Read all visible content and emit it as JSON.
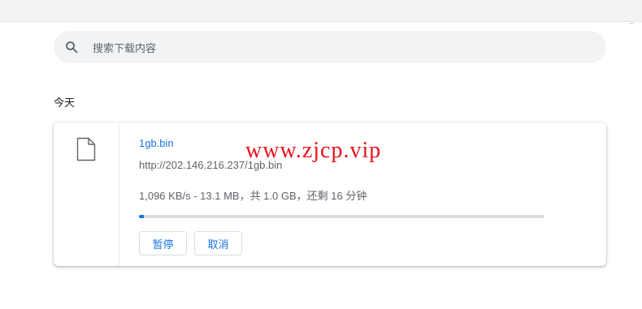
{
  "search": {
    "placeholder": "搜索下载内容",
    "icon": "search-icon"
  },
  "section": {
    "title": "今天"
  },
  "download": {
    "file_name": "1gb.bin",
    "url": "http://202.146.216.237/1gb.bin",
    "status_text": "1,096 KB/s - 13.1 MB，共 1.0 GB，还剩 16 分钟",
    "progress": 0.0128,
    "file_icon": "file-icon",
    "buttons": {
      "pause": "暂停",
      "cancel": "取消"
    }
  },
  "watermark": {
    "text": "www.zjcp.vip"
  },
  "colors": {
    "accent": "#1a73e8",
    "watermark": "#e8131c",
    "track": "#dadce0"
  }
}
